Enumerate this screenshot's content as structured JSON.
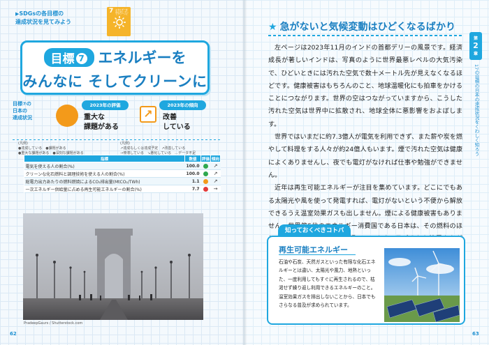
{
  "left": {
    "intro_line1": "SDGsの各目標の",
    "intro_line2": "達成状況を見てみよう",
    "goal_icon": {
      "number": "7",
      "caption": "エネルギーをみんなに そしてクリーンに",
      "color": "#f5b42a"
    },
    "title": {
      "goal_badge": "目標",
      "goal_number": "7",
      "line1": "エネルギーを",
      "line2": "みんなに そしてクリーンに"
    },
    "status_label_1": "目標⑦の",
    "status_label_2": "日本の",
    "status_label_3": "達成状況",
    "evaluation": {
      "head": "2023年の評価",
      "line1": "重大な",
      "line2": "課題がある",
      "color": "#f39a1a"
    },
    "trend": {
      "head": "2023年の傾向",
      "line1": "改善",
      "line2": "している",
      "icon": "arrow-up-right-icon"
    },
    "legend": {
      "left_title": "(凡例)",
      "left_1": "●達成している　●課題がある",
      "left_2": "●重大な課題がある　●深刻な課題がある",
      "right_title": "(凡例)",
      "right_1": "↗達成もしくは達成予定　↗改善している",
      "right_2": "→停滞している　↘悪化している　…データ不足"
    },
    "table": {
      "headers": [
        "指標",
        "数値",
        "評価",
        "傾向"
      ],
      "rows": [
        {
          "label": "電気を使える人の割合(%)",
          "value": "100.0",
          "eval_color": "#2fa84f",
          "trend": "↗"
        },
        {
          "label": "クリーンな化石燃料と調理技術を使える人の割合(%)",
          "value": "100.0",
          "eval_color": "#2fa84f",
          "trend": "↗"
        },
        {
          "label": "総電力出力あたりの燃料燃焼によるCO₂排出量(MtCO₂/TWh)",
          "value": "1.1",
          "eval_color": "#f39a1a",
          "trend": "↗"
        },
        {
          "label": "一次エネルギー供給量に占める再生可能エネルギーの割合(%)",
          "value": "7.7",
          "eval_color": "#e23b3b",
          "trend": "→"
        }
      ]
    },
    "photo_credit": "PradeepGaurs / Shutterstock.com",
    "page_number": "62"
  },
  "right": {
    "section_title": "急がないと気候変動はひどくなるばかり",
    "paragraphs": [
      "左ページは2023年11月のインドの首都デリーの風景です。経済成長が著しいインドは、写真のように世界最悪レベルの大気汚染で、ひどいときには汚れた空気で数十メートル先が見えなくなるほどです。健康被害はもちろんのこと、地球温暖化にも拍車をかけることにつながります。世界の空はつながっていますから、こうした汚れた空気は世界中に拡散され、地球全体に悪影響をおよぼします。",
      "世界ではいまだに約7.3億人が電気を利用できず、また薪や炭を燃やして料理をする人々が約24億人もいます。煙で汚れた空気は健康によくありませんし、夜でも電灯がなければ仕事や勉強ができません。",
      "近年は再生可能エネルギーが注目を集めています。どこにでもある太陽光や風を使って発電すれば、電灯がないという不便から解放できるうえ温室効果ガスも出しません。煙による健康被害もありません。世界第5位のエネルギー消費国である日本は、その燃料のほとんどを海外からの輸入に頼っています。日ごろから節電を心がけ、エネルギーを上手に使う工夫をすることは、私たちにできることです。"
    ],
    "side_tab": {
      "label": "第",
      "number": "2",
      "suffix": "章"
    },
    "side_text": "17の目標の日本の達成状況をくわしく知ろう",
    "kotoba": {
      "tab": "知っておくべきコトバ",
      "term": "再生可能エネルギー",
      "text": "石油や石炭、天然ガスといった有限な化石エネルギーとは違い、太陽光や風力、地熱といった、一度利用してもすぐに再生されるので、枯渇せず繰り返し利用できるエネルギーのこと。温室効果ガスを排出しないことから、日本でもさらなる普及が求められています。"
    },
    "page_number": "63"
  }
}
